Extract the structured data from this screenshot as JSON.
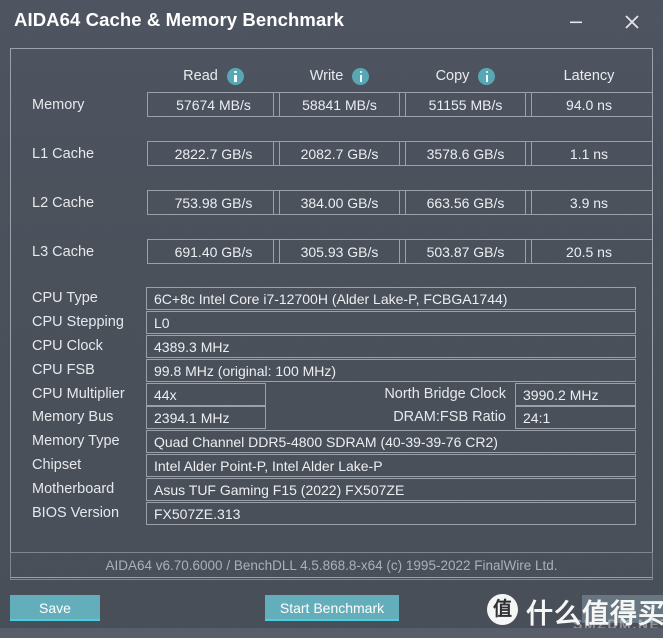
{
  "window": {
    "title": "AIDA64 Cache & Memory Benchmark",
    "minimize_label": "minimize",
    "close_label": "close"
  },
  "bench": {
    "columns": [
      {
        "label": "Read",
        "info": "i"
      },
      {
        "label": "Write",
        "info": "i"
      },
      {
        "label": "Copy",
        "info": "i"
      },
      {
        "label": "Latency",
        "info": ""
      }
    ],
    "rows": [
      {
        "label": "Memory",
        "read": "57674 MB/s",
        "write": "58841 MB/s",
        "copy": "51155 MB/s",
        "latency": "94.0 ns"
      },
      {
        "label": "L1 Cache",
        "read": "2822.7 GB/s",
        "write": "2082.7 GB/s",
        "copy": "3578.6 GB/s",
        "latency": "1.1 ns"
      },
      {
        "label": "L2 Cache",
        "read": "753.98 GB/s",
        "write": "384.00 GB/s",
        "copy": "663.56 GB/s",
        "latency": "3.9 ns"
      },
      {
        "label": "L3 Cache",
        "read": "691.40 GB/s",
        "write": "305.93 GB/s",
        "copy": "503.87 GB/s",
        "latency": "20.5 ns"
      }
    ]
  },
  "cpu": {
    "type_label": "CPU Type",
    "type_value": "6C+8c Intel Core i7-12700H  (Alder Lake-P, FCBGA1744)",
    "stepping_label": "CPU Stepping",
    "stepping_value": "L0",
    "clock_label": "CPU Clock",
    "clock_value": "4389.3 MHz",
    "fsb_label": "CPU FSB",
    "fsb_value": "99.8 MHz  (original: 100 MHz)",
    "multiplier_label": "CPU Multiplier",
    "multiplier_value": "44x",
    "nb_clock_label": "North Bridge Clock",
    "nb_clock_value": "3990.2 MHz"
  },
  "memory": {
    "bus_label": "Memory Bus",
    "bus_value": "2394.1 MHz",
    "ratio_label": "DRAM:FSB Ratio",
    "ratio_value": "24:1",
    "type_label": "Memory Type",
    "type_value": "Quad Channel DDR5-4800 SDRAM  (40-39-39-76 CR2)",
    "chipset_label": "Chipset",
    "chipset_value": "Intel Alder Point-P, Intel Alder Lake-P",
    "motherboard_label": "Motherboard",
    "motherboard_value": "Asus TUF Gaming F15 (2022) FX507ZE",
    "bios_label": "BIOS Version",
    "bios_value": "FX507ZE.313"
  },
  "footer": {
    "version_text": "AIDA64 v6.70.6000 / BenchDLL 4.5.868.8-x64  (c) 1995-2022 FinalWire Ltd.",
    "save_label": "Save",
    "start_label": "Start Benchmark"
  },
  "watermark": {
    "mark": "值",
    "text": "什么值得买",
    "sub": "SMZDM.NET"
  },
  "colors": {
    "background": "#4b515b",
    "accent_teal": "#64aebb",
    "info_icon": "#58a7b4",
    "border": "#9aa1ab",
    "text": "#e8eaee",
    "muted_text": "#a9b0ba"
  }
}
